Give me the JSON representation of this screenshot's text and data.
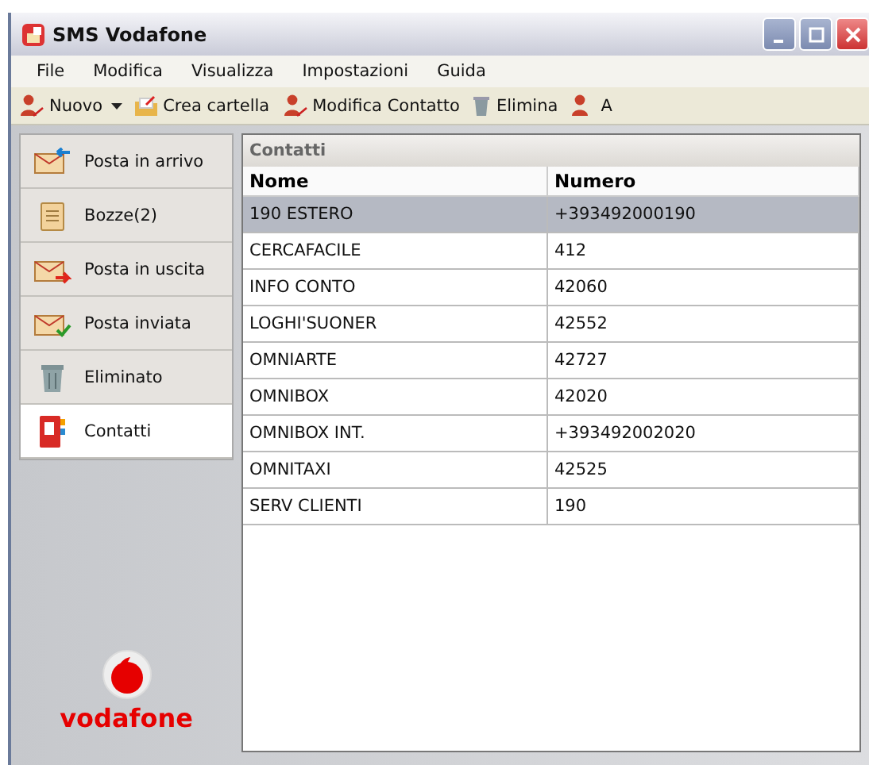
{
  "window": {
    "title": "SMS Vodafone"
  },
  "menu": [
    "File",
    "Modifica",
    "Visualizza",
    "Impostazioni",
    "Guida"
  ],
  "toolbar": [
    {
      "kind": "new",
      "label": "Nuovo"
    },
    {
      "kind": "dropdown"
    },
    {
      "kind": "folder",
      "label": "Crea cartella"
    },
    {
      "kind": "edit",
      "label": "Modifica Contatto"
    },
    {
      "kind": "delete",
      "label": "Elimina"
    },
    {
      "kind": "person",
      "label": "A"
    }
  ],
  "sidebar": {
    "items": [
      {
        "kind": "inbox",
        "label": "Posta in arrivo",
        "selected": false
      },
      {
        "kind": "drafts",
        "label": "Bozze(2)",
        "selected": false
      },
      {
        "kind": "outbox",
        "label": "Posta in uscita",
        "selected": false
      },
      {
        "kind": "sent",
        "label": "Posta inviata",
        "selected": false
      },
      {
        "kind": "trash",
        "label": "Eliminato",
        "selected": false
      },
      {
        "kind": "contacts",
        "label": "Contatti",
        "selected": true
      }
    ],
    "logo": "vodafone"
  },
  "panel": {
    "title": "Contatti"
  },
  "table": {
    "columns": [
      "Nome",
      "Numero"
    ],
    "rows": [
      {
        "cells": [
          "190 ESTERO",
          "+393492000190"
        ],
        "selected": true
      },
      {
        "cells": [
          "CERCAFACILE",
          "412"
        ],
        "selected": false
      },
      {
        "cells": [
          "INFO CONTO",
          "42060"
        ],
        "selected": false
      },
      {
        "cells": [
          "LOGHI'SUONER",
          "42552"
        ],
        "selected": false
      },
      {
        "cells": [
          "OMNIARTE",
          "42727"
        ],
        "selected": false
      },
      {
        "cells": [
          "OMNIBOX",
          "42020"
        ],
        "selected": false
      },
      {
        "cells": [
          "OMNIBOX INT.",
          "+393492002020"
        ],
        "selected": false
      },
      {
        "cells": [
          "OMNITAXI",
          "42525"
        ],
        "selected": false
      },
      {
        "cells": [
          "SERV CLIENTI",
          "190"
        ],
        "selected": false
      }
    ]
  }
}
